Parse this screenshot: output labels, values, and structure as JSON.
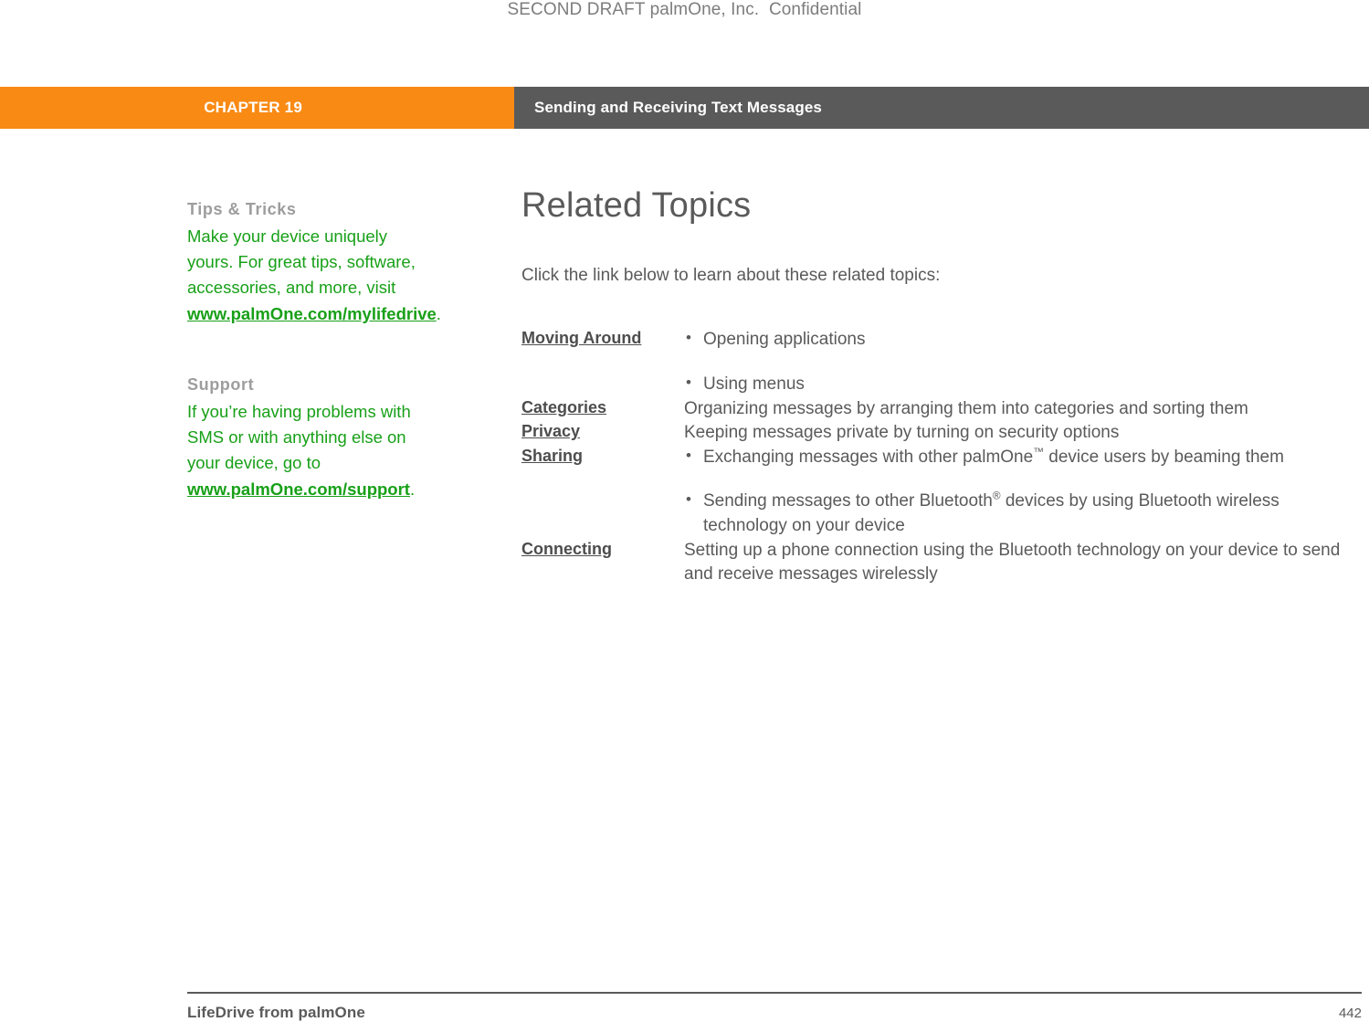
{
  "draft_notice": "SECOND DRAFT palmOne, Inc.  Confidential",
  "header": {
    "chapter_label": "CHAPTER 19",
    "topic_label": "Sending and Receiving Text Messages",
    "chapter_bg": "#F98A14",
    "topic_bg": "#5A5A5A"
  },
  "sidebar": {
    "accent_color": "#18A018",
    "heading_color": "#9d9d9d",
    "blocks": [
      {
        "heading": "Tips & Tricks",
        "text_before": "Make your device uniquely yours. For great tips, software, accessories, and more, visit ",
        "link": "www.palmOne.com/mylifedrive",
        "text_after": "."
      },
      {
        "heading": "Support",
        "text_before": "If you’re having problems with SMS or with anything else on your device, go to ",
        "link": "www.palmOne.com/support",
        "text_after": "."
      }
    ]
  },
  "main": {
    "title": "Related Topics",
    "intro": "Click the link below to learn about these related topics:",
    "topics": [
      {
        "link": "Moving Around",
        "bullets": [
          "Opening applications",
          "Using menus"
        ]
      },
      {
        "link": "Categories",
        "description": "Organizing messages by arranging them into categories and sorting them"
      },
      {
        "link": "Privacy",
        "description": "Keeping messages private by turning on security options"
      },
      {
        "link": "Sharing",
        "bullets_rich": [
          {
            "before": "Exchanging messages with other palmOne",
            "mark": "™",
            "after": " device users by beaming them"
          },
          {
            "before": "Sending messages to other Bluetooth",
            "mark": "®",
            "after": " devices by using Bluetooth wireless technology on your device"
          }
        ]
      },
      {
        "link": "Connecting",
        "description": "Setting up a phone connection using the Bluetooth technology on your device to send and receive messages wirelessly"
      }
    ]
  },
  "footer": {
    "product": "LifeDrive from palmOne",
    "page_number": "442"
  }
}
